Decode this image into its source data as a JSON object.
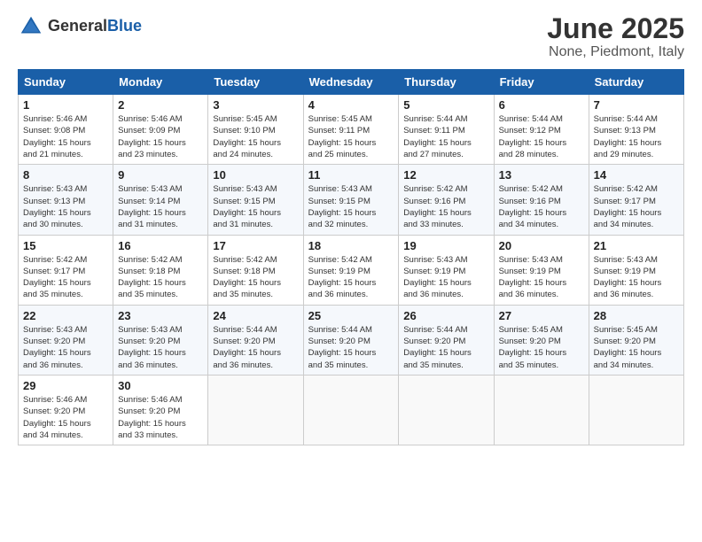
{
  "header": {
    "logo_general": "General",
    "logo_blue": "Blue",
    "title": "June 2025",
    "subtitle": "None, Piedmont, Italy"
  },
  "days_of_week": [
    "Sunday",
    "Monday",
    "Tuesday",
    "Wednesday",
    "Thursday",
    "Friday",
    "Saturday"
  ],
  "weeks": [
    [
      {
        "day": "1",
        "info": "Sunrise: 5:46 AM\nSunset: 9:08 PM\nDaylight: 15 hours\nand 21 minutes."
      },
      {
        "day": "2",
        "info": "Sunrise: 5:46 AM\nSunset: 9:09 PM\nDaylight: 15 hours\nand 23 minutes."
      },
      {
        "day": "3",
        "info": "Sunrise: 5:45 AM\nSunset: 9:10 PM\nDaylight: 15 hours\nand 24 minutes."
      },
      {
        "day": "4",
        "info": "Sunrise: 5:45 AM\nSunset: 9:11 PM\nDaylight: 15 hours\nand 25 minutes."
      },
      {
        "day": "5",
        "info": "Sunrise: 5:44 AM\nSunset: 9:11 PM\nDaylight: 15 hours\nand 27 minutes."
      },
      {
        "day": "6",
        "info": "Sunrise: 5:44 AM\nSunset: 9:12 PM\nDaylight: 15 hours\nand 28 minutes."
      },
      {
        "day": "7",
        "info": "Sunrise: 5:44 AM\nSunset: 9:13 PM\nDaylight: 15 hours\nand 29 minutes."
      }
    ],
    [
      {
        "day": "8",
        "info": "Sunrise: 5:43 AM\nSunset: 9:13 PM\nDaylight: 15 hours\nand 30 minutes."
      },
      {
        "day": "9",
        "info": "Sunrise: 5:43 AM\nSunset: 9:14 PM\nDaylight: 15 hours\nand 31 minutes."
      },
      {
        "day": "10",
        "info": "Sunrise: 5:43 AM\nSunset: 9:15 PM\nDaylight: 15 hours\nand 31 minutes."
      },
      {
        "day": "11",
        "info": "Sunrise: 5:43 AM\nSunset: 9:15 PM\nDaylight: 15 hours\nand 32 minutes."
      },
      {
        "day": "12",
        "info": "Sunrise: 5:42 AM\nSunset: 9:16 PM\nDaylight: 15 hours\nand 33 minutes."
      },
      {
        "day": "13",
        "info": "Sunrise: 5:42 AM\nSunset: 9:16 PM\nDaylight: 15 hours\nand 34 minutes."
      },
      {
        "day": "14",
        "info": "Sunrise: 5:42 AM\nSunset: 9:17 PM\nDaylight: 15 hours\nand 34 minutes."
      }
    ],
    [
      {
        "day": "15",
        "info": "Sunrise: 5:42 AM\nSunset: 9:17 PM\nDaylight: 15 hours\nand 35 minutes."
      },
      {
        "day": "16",
        "info": "Sunrise: 5:42 AM\nSunset: 9:18 PM\nDaylight: 15 hours\nand 35 minutes."
      },
      {
        "day": "17",
        "info": "Sunrise: 5:42 AM\nSunset: 9:18 PM\nDaylight: 15 hours\nand 35 minutes."
      },
      {
        "day": "18",
        "info": "Sunrise: 5:42 AM\nSunset: 9:19 PM\nDaylight: 15 hours\nand 36 minutes."
      },
      {
        "day": "19",
        "info": "Sunrise: 5:43 AM\nSunset: 9:19 PM\nDaylight: 15 hours\nand 36 minutes."
      },
      {
        "day": "20",
        "info": "Sunrise: 5:43 AM\nSunset: 9:19 PM\nDaylight: 15 hours\nand 36 minutes."
      },
      {
        "day": "21",
        "info": "Sunrise: 5:43 AM\nSunset: 9:19 PM\nDaylight: 15 hours\nand 36 minutes."
      }
    ],
    [
      {
        "day": "22",
        "info": "Sunrise: 5:43 AM\nSunset: 9:20 PM\nDaylight: 15 hours\nand 36 minutes."
      },
      {
        "day": "23",
        "info": "Sunrise: 5:43 AM\nSunset: 9:20 PM\nDaylight: 15 hours\nand 36 minutes."
      },
      {
        "day": "24",
        "info": "Sunrise: 5:44 AM\nSunset: 9:20 PM\nDaylight: 15 hours\nand 36 minutes."
      },
      {
        "day": "25",
        "info": "Sunrise: 5:44 AM\nSunset: 9:20 PM\nDaylight: 15 hours\nand 35 minutes."
      },
      {
        "day": "26",
        "info": "Sunrise: 5:44 AM\nSunset: 9:20 PM\nDaylight: 15 hours\nand 35 minutes."
      },
      {
        "day": "27",
        "info": "Sunrise: 5:45 AM\nSunset: 9:20 PM\nDaylight: 15 hours\nand 35 minutes."
      },
      {
        "day": "28",
        "info": "Sunrise: 5:45 AM\nSunset: 9:20 PM\nDaylight: 15 hours\nand 34 minutes."
      }
    ],
    [
      {
        "day": "29",
        "info": "Sunrise: 5:46 AM\nSunset: 9:20 PM\nDaylight: 15 hours\nand 34 minutes."
      },
      {
        "day": "30",
        "info": "Sunrise: 5:46 AM\nSunset: 9:20 PM\nDaylight: 15 hours\nand 33 minutes."
      },
      {
        "day": "",
        "info": ""
      },
      {
        "day": "",
        "info": ""
      },
      {
        "day": "",
        "info": ""
      },
      {
        "day": "",
        "info": ""
      },
      {
        "day": "",
        "info": ""
      }
    ]
  ]
}
